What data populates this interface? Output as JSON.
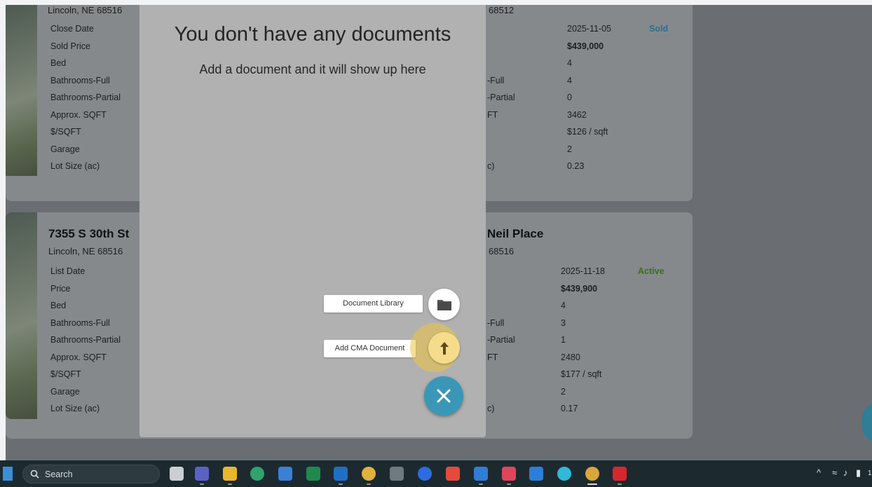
{
  "modal": {
    "title": "You don't have any documents",
    "subtitle": "Add a document and it will show up here"
  },
  "fab_menu": {
    "document_library_label": "Document Library",
    "add_cma_label": "Add CMA Document",
    "close_icon": "close-icon",
    "folder_icon": "folder-icon",
    "upload_icon": "upload-arrow-icon"
  },
  "listing_top_left": {
    "city": "Lincoln, NE 68516",
    "labels": [
      "Close Date",
      "Sold Price",
      "Bed",
      "Bathrooms-Full",
      "Bathrooms-Partial",
      "Approx. SQFT",
      "$/SQFT",
      "Garage",
      "Lot Size (ac)"
    ]
  },
  "listing_top_right": {
    "city_fragment": "68512",
    "label_fragments": [
      "-Full",
      "-Partial",
      "FT",
      "c)"
    ],
    "values": [
      "2025-11-05",
      "$439,000",
      "4",
      "4",
      "0",
      "3462",
      "$126 / sqft",
      "2",
      "0.23"
    ],
    "status": "Sold",
    "status_color": "#2b6f8f"
  },
  "listing_bottom_left": {
    "address": "7355 S 30th St",
    "city": "Lincoln, NE 68516",
    "labels": [
      "List Date",
      "Price",
      "Bed",
      "Bathrooms-Full",
      "Bathrooms-Partial",
      "Approx. SQFT",
      "$/SQFT",
      "Garage",
      "Lot Size (ac)"
    ]
  },
  "listing_bottom_right": {
    "address_fragment": "Neil Place",
    "city_fragment": "68516",
    "label_fragments": [
      "-Full",
      "-Partial",
      "FT",
      "c)"
    ],
    "values": [
      "2025-11-18",
      "$439,900",
      "4",
      "3",
      "1",
      "2480",
      "$177 / sqft",
      "2",
      "0.17"
    ],
    "status": "Active",
    "status_color": "#3d6d1d"
  },
  "taskbar": {
    "search_label": "Search",
    "search_icon": "search-icon",
    "apps": [
      "task-view-icon",
      "teams-icon",
      "file-explorer-icon",
      "edge-icon",
      "app-icon",
      "excel-icon",
      "outlook-icon",
      "chrome-icon",
      "calculator-icon",
      "zoom-icon",
      "slides-app-icon",
      "r-app-icon",
      "app-icon",
      "docs-app-icon",
      "c-app-icon",
      "chrome-icon",
      "acrobat-icon"
    ],
    "tray_icons": [
      "chevron-up-icon",
      "wifi-icon",
      "volume-icon",
      "battery-icon"
    ],
    "clock_fragment": "1"
  },
  "colors": {
    "overlay_page": "#6a6e72",
    "modal_bg": "#b1b1b1",
    "fab_main": "#3b97b7",
    "highlight": "#ecc440"
  }
}
